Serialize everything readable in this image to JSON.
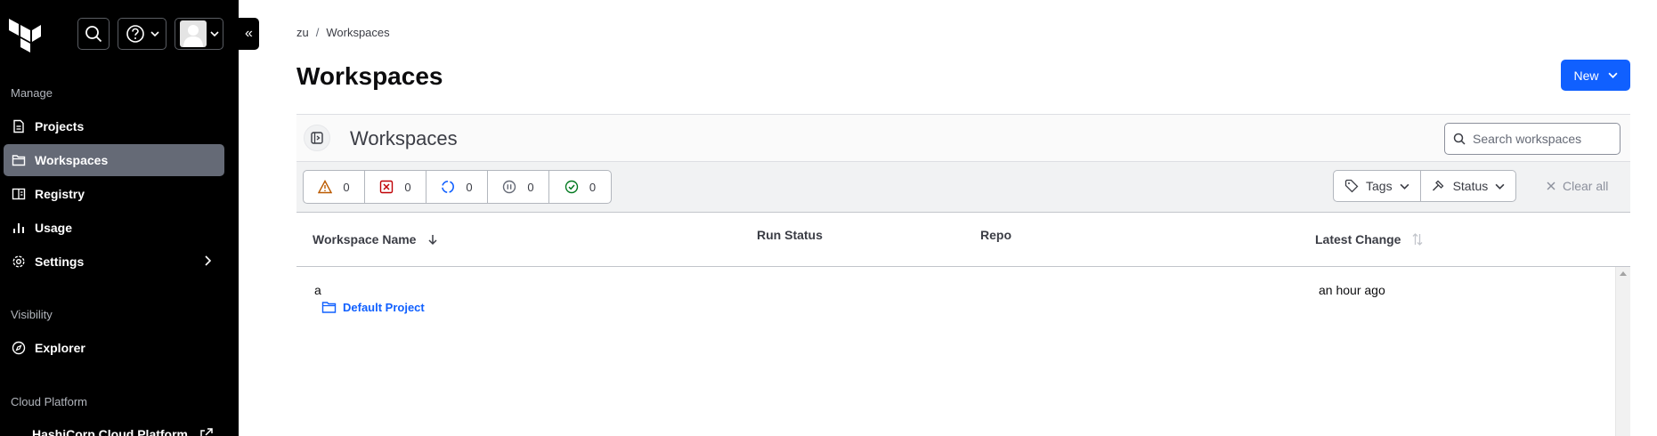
{
  "sidebar": {
    "sections": [
      {
        "label": "Manage"
      },
      {
        "label": "Visibility"
      },
      {
        "label": "Cloud Platform"
      }
    ],
    "items": [
      {
        "label": "Projects",
        "icon": "file-icon"
      },
      {
        "label": "Workspaces",
        "icon": "folder-icon",
        "active": true
      },
      {
        "label": "Registry",
        "icon": "book-icon"
      },
      {
        "label": "Usage",
        "icon": "bar-chart-icon"
      },
      {
        "label": "Settings",
        "icon": "gear-icon"
      },
      {
        "label": "Explorer",
        "icon": "compass-icon"
      },
      {
        "label": "HashiCorp Cloud Platform",
        "icon": "external-link-icon"
      }
    ],
    "collapse_glyph": "«"
  },
  "breadcrumb": {
    "org": "zu",
    "separator": "/",
    "current": "Workspaces"
  },
  "page": {
    "title": "Workspaces",
    "new_label": "New"
  },
  "panel": {
    "title": "Workspaces",
    "search_placeholder": "Search workspaces"
  },
  "status_filters": [
    {
      "icon": "warning-icon",
      "count": "0",
      "color": "#bb5a00"
    },
    {
      "icon": "error-icon",
      "count": "0",
      "color": "#c00005"
    },
    {
      "icon": "running-icon",
      "count": "0",
      "color": "#1060ff"
    },
    {
      "icon": "paused-icon",
      "count": "0",
      "color": "#656a76"
    },
    {
      "icon": "check-icon",
      "count": "0",
      "color": "#00781e"
    }
  ],
  "filters": {
    "tags_label": "Tags",
    "status_label": "Status",
    "clear_label": "Clear all"
  },
  "table": {
    "columns": [
      "Workspace Name",
      "Run Status",
      "Repo",
      "Latest Change"
    ],
    "rows": [
      {
        "name": "a",
        "project": "Default Project",
        "run_status": "",
        "repo": "",
        "latest_change": "an hour ago"
      }
    ]
  },
  "colors": {
    "accent": "#1060ff",
    "sidebar_bg": "#000000",
    "active_item": "#656a76"
  }
}
